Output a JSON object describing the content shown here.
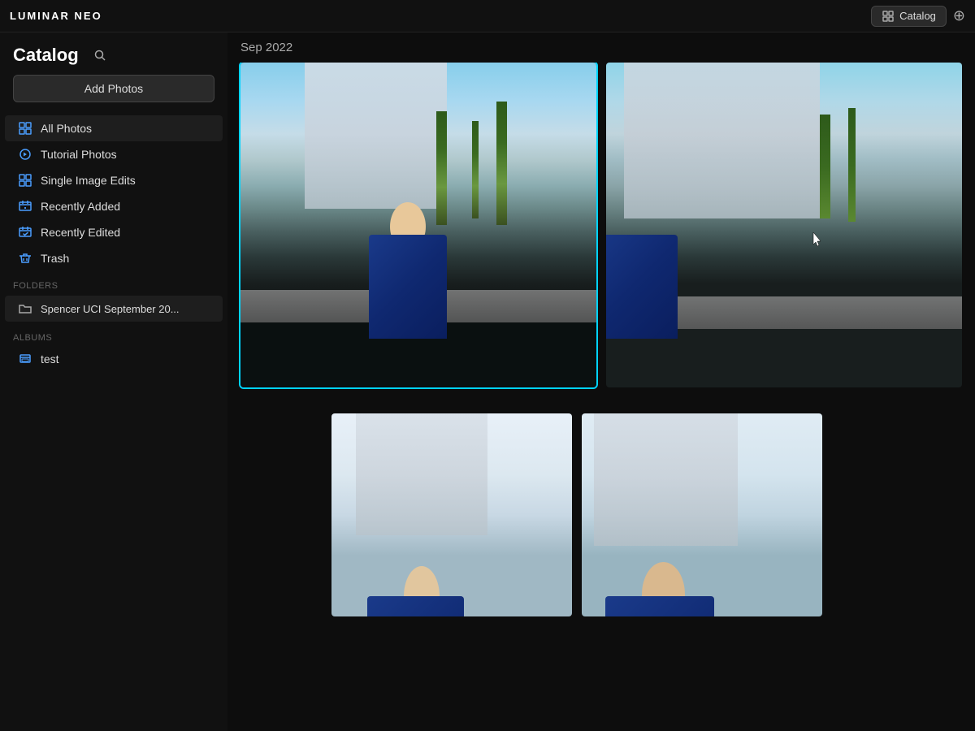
{
  "app": {
    "logo": "LUMINAR NEO",
    "catalog_label": "Catalog"
  },
  "topbar": {
    "catalog_button": "Catalog",
    "extensions_icon": "extensions-icon"
  },
  "sidebar": {
    "title": "Catalog",
    "add_photos_label": "Add Photos",
    "search_placeholder": "Search",
    "date_display": "Sep 2022",
    "nav_items": [
      {
        "id": "all-photos",
        "label": "All Photos",
        "icon": "catalog-icon",
        "active": true
      },
      {
        "id": "tutorial-photos",
        "label": "Tutorial Photos",
        "icon": "tutorial-icon",
        "active": false
      },
      {
        "id": "single-image-edits",
        "label": "Single Image Edits",
        "icon": "grid-icon",
        "active": false
      },
      {
        "id": "recently-added",
        "label": "Recently Added",
        "icon": "recently-added-icon",
        "active": false
      },
      {
        "id": "recently-edited",
        "label": "Recently Edited",
        "icon": "recently-edited-icon",
        "active": false
      },
      {
        "id": "trash",
        "label": "Trash",
        "icon": "trash-icon",
        "active": false
      }
    ],
    "folders_label": "Folders",
    "folders": [
      {
        "id": "spencer-uci",
        "label": "Spencer UCI September 20..."
      }
    ],
    "albums_label": "Albums",
    "albums": [
      {
        "id": "test-album",
        "label": "test"
      }
    ]
  },
  "content": {
    "date_header": "Sep 2022",
    "photos": [
      {
        "id": "photo-1",
        "label": "photo-1",
        "selected": true
      },
      {
        "id": "photo-2",
        "label": "photo-2",
        "selected": false
      },
      {
        "id": "photo-3",
        "label": "photo-3",
        "selected": false
      },
      {
        "id": "photo-4",
        "label": "photo-4",
        "selected": false
      }
    ]
  }
}
